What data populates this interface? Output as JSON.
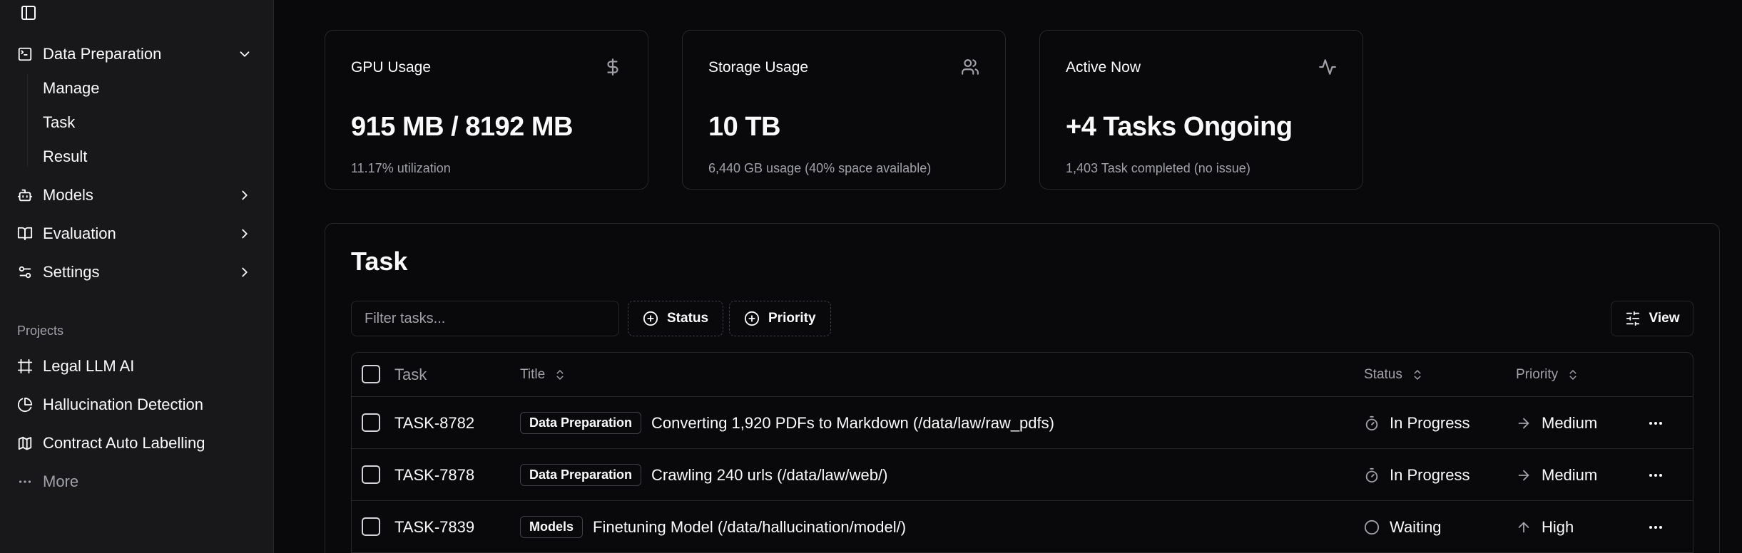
{
  "sidebar": {
    "nav": [
      {
        "label": "Data Preparation",
        "icon": "terminal-square-icon",
        "expanded": true
      },
      {
        "label": "Models",
        "icon": "bot-icon"
      },
      {
        "label": "Evaluation",
        "icon": "book-open-icon"
      },
      {
        "label": "Settings",
        "icon": "sliders-icon"
      }
    ],
    "sub_items": [
      "Manage",
      "Task",
      "Result"
    ],
    "projects_label": "Projects",
    "projects": [
      {
        "label": "Legal LLM AI",
        "icon": "frame-icon"
      },
      {
        "label": "Hallucination Detection",
        "icon": "pie-chart-icon"
      },
      {
        "label": "Contract Auto Labelling",
        "icon": "map-icon"
      }
    ],
    "more_label": "More"
  },
  "cards": [
    {
      "title": "GPU Usage",
      "icon": "dollar-icon",
      "value": "915 MB / 8192 MB",
      "sub": "11.17% utilization"
    },
    {
      "title": "Storage Usage",
      "icon": "users-icon",
      "value": "10 TB",
      "sub": "6,440 GB usage (40% space available)"
    },
    {
      "title": "Active Now",
      "icon": "activity-icon",
      "value": "+4 Tasks Ongoing",
      "sub": "1,403 Task completed (no issue)"
    }
  ],
  "tasks": {
    "title": "Task",
    "filter_placeholder": "Filter tasks...",
    "status_btn": "Status",
    "priority_btn": "Priority",
    "view_btn": "View",
    "columns": {
      "task": "Task",
      "title": "Title",
      "status": "Status",
      "priority": "Priority"
    },
    "rows": [
      {
        "id": "TASK-8782",
        "label": "Data Preparation",
        "title": "Converting 1,920 PDFs to Markdown (/data/law/raw_pdfs)",
        "status": "In Progress",
        "priority": "Medium"
      },
      {
        "id": "TASK-7878",
        "label": "Data Preparation",
        "title": "Crawling 240 urls (/data/law/web/)",
        "status": "In Progress",
        "priority": "Medium"
      },
      {
        "id": "TASK-7839",
        "label": "Models",
        "title": "Finetuning Model (/data/hallucination/model/)",
        "status": "Waiting",
        "priority": "High"
      }
    ]
  }
}
